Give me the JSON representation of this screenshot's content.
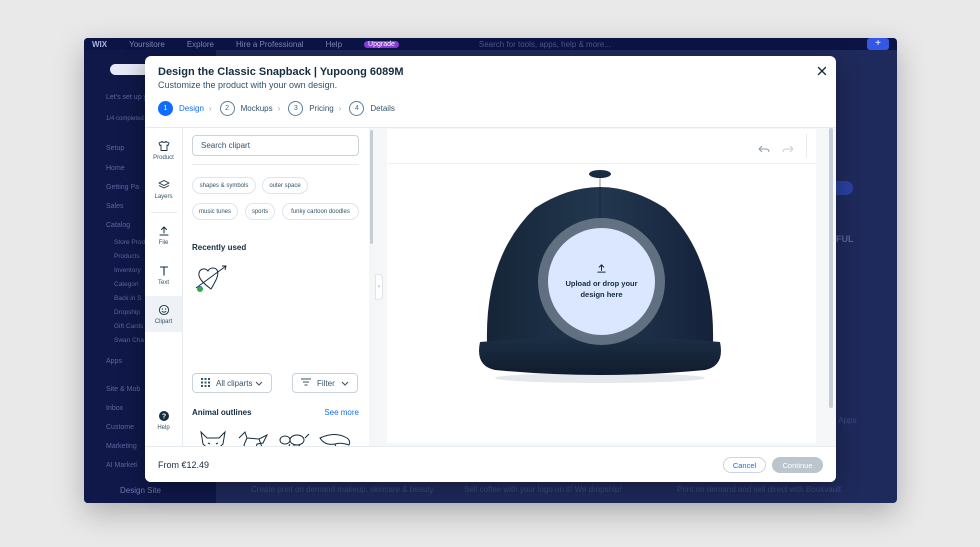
{
  "background": {
    "logo": "WIX",
    "topnav": [
      "Yoursitore",
      "Explore",
      "Hire a Professional",
      "Help"
    ],
    "upgrade": "Upgrade",
    "search": "Search for tools, apps, help & more...",
    "sidebar_heading": "Let's set up yo",
    "sidebar_progress": "1/4 completed",
    "sidebar_items": [
      "Setup",
      "Home",
      "Getting Pa",
      "Sales",
      "Catalog"
    ],
    "sidebar_subitems": [
      "Store Prod",
      "Products",
      "Inventory",
      "Categori",
      "Back in S",
      "Dropship",
      "Gift Cards",
      "Swan Cha"
    ],
    "sidebar_items2": [
      "Apps",
      "Site & Mob",
      "Inbox",
      "Custome",
      "Marketing",
      "AI Marketi"
    ],
    "design_site": "Design Site",
    "bottom_texts": [
      "Create print on demand makeup, skincare & beauty",
      "Sell coffee with your logo on it! We dropship!",
      "Print on demand and sell direct with Bookvault"
    ],
    "right_text": "FUL",
    "right_text2": "e Apps"
  },
  "modal": {
    "title": "Design the Classic Snapback | Yupoong 6089M",
    "subtitle": "Customize the product with your own design.",
    "steps": [
      {
        "num": "1",
        "label": "Design"
      },
      {
        "num": "2",
        "label": "Mockups"
      },
      {
        "num": "3",
        "label": "Pricing"
      },
      {
        "num": "4",
        "label": "Details"
      }
    ],
    "tools": [
      "Product",
      "Layers",
      "File",
      "Text",
      "Clipart",
      "Help"
    ],
    "search_placeholder": "Search clipart",
    "chips": [
      "shapes & symbols",
      "outer space",
      "music tunes",
      "sports",
      "funky cartoon doodles"
    ],
    "recently_used": "Recently used",
    "all_cliparts": "All cliparts",
    "filter": "Filter",
    "animal_outlines": "Animal outlines",
    "see_more": "See more",
    "upload_text": "Upload or drop your design here",
    "price": "From €12.49",
    "cancel": "Cancel",
    "continue": "Continue"
  },
  "colors": {
    "accent": "#116dff",
    "cap": "#1e3146",
    "upload_fill": "#dbe6ff"
  }
}
